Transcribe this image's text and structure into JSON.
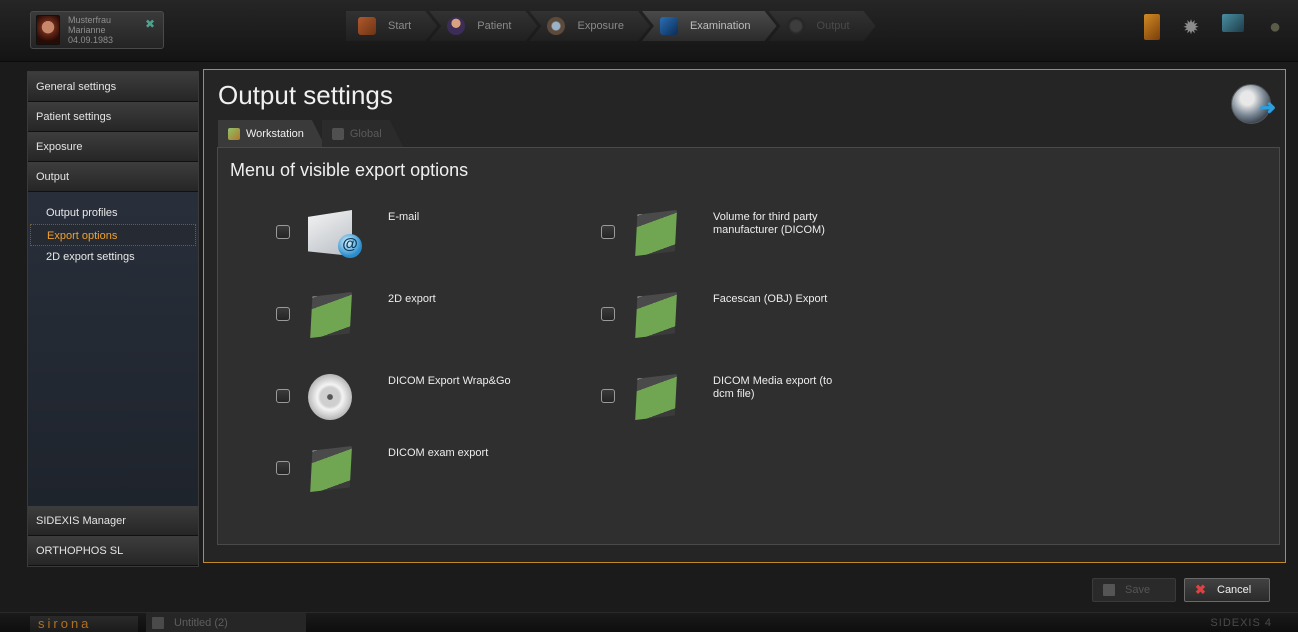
{
  "patient": {
    "last_name": "Musterfrau",
    "first_name": "Marianne",
    "dob": "04.09.1983"
  },
  "workflow": {
    "steps": [
      {
        "label": "Start",
        "icon": "start-icon"
      },
      {
        "label": "Patient",
        "icon": "patient-icon"
      },
      {
        "label": "Exposure",
        "icon": "exposure-icon"
      },
      {
        "label": "Examination",
        "icon": "examination-icon"
      },
      {
        "label": "Output",
        "icon": "output-icon"
      }
    ]
  },
  "sidebar": {
    "top_items": [
      "General settings",
      "Patient settings",
      "Exposure",
      "Output"
    ],
    "sub_items": [
      "Output profiles",
      "Export options",
      "2D export settings"
    ],
    "selected_sub_item": "Export options",
    "bottom_items": [
      "SIDEXIS Manager",
      "ORTHOPHOS SL"
    ]
  },
  "main": {
    "title": "Output settings",
    "tabs": [
      "Workstation",
      "Global"
    ],
    "active_tab": "Workstation",
    "heading": "Menu of visible export options",
    "options_left": [
      {
        "label": "E-mail",
        "icon": "email-icon",
        "checked": false
      },
      {
        "label": "2D export",
        "icon": "floppy-icon",
        "checked": false
      },
      {
        "label": "DICOM Export Wrap&Go",
        "icon": "disc-icon",
        "checked": false
      },
      {
        "label": "DICOM exam export",
        "icon": "floppy-icon",
        "checked": false
      }
    ],
    "options_right": [
      {
        "label": "Volume for third party manufacturer (DICOM)",
        "icon": "floppy-icon",
        "checked": false
      },
      {
        "label": "Facescan (OBJ) Export",
        "icon": "floppy-icon",
        "checked": false
      },
      {
        "label": "DICOM Media export  (to dcm file)",
        "icon": "floppy-icon",
        "checked": false
      }
    ]
  },
  "actions": {
    "save_label": "Save",
    "cancel_label": "Cancel"
  },
  "statusbar": {
    "brand": "sirona",
    "document": "Untitled (2)",
    "product": "SIDEXIS 4"
  },
  "colors": {
    "accent": "#c08a2a",
    "selected_text": "#f0a030"
  }
}
